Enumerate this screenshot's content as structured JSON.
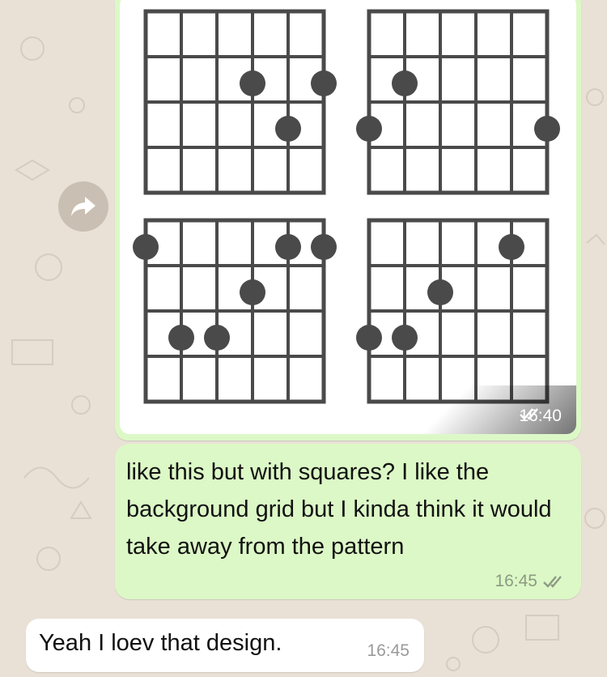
{
  "chat": {
    "messages": [
      {
        "direction": "outgoing",
        "type": "image",
        "time": "16:40",
        "status_icon": "double-check-icon",
        "image_content": {
          "kind": "guitar chord diagrams",
          "diagram_count": 4,
          "strings": 6,
          "frets": 4
        }
      },
      {
        "direction": "outgoing",
        "type": "text",
        "text": "like this but with squares? I like the background grid but I kinda think it would take away from the pattern",
        "time": "16:45",
        "status_icon": "double-check-icon"
      },
      {
        "direction": "incoming",
        "type": "text",
        "text": "Yeah I loev that design.",
        "time": "16:45"
      }
    ]
  },
  "forward_icon": "forward-arrow-icon",
  "colors": {
    "chat_background": "#e9e1d6",
    "outgoing_bubble": "#dcf8c6",
    "incoming_bubble": "#ffffff",
    "forward_button": "#c9bfb2",
    "diagram_lines": "#4a4a4a",
    "check_marks_read": "#8d9a84"
  }
}
